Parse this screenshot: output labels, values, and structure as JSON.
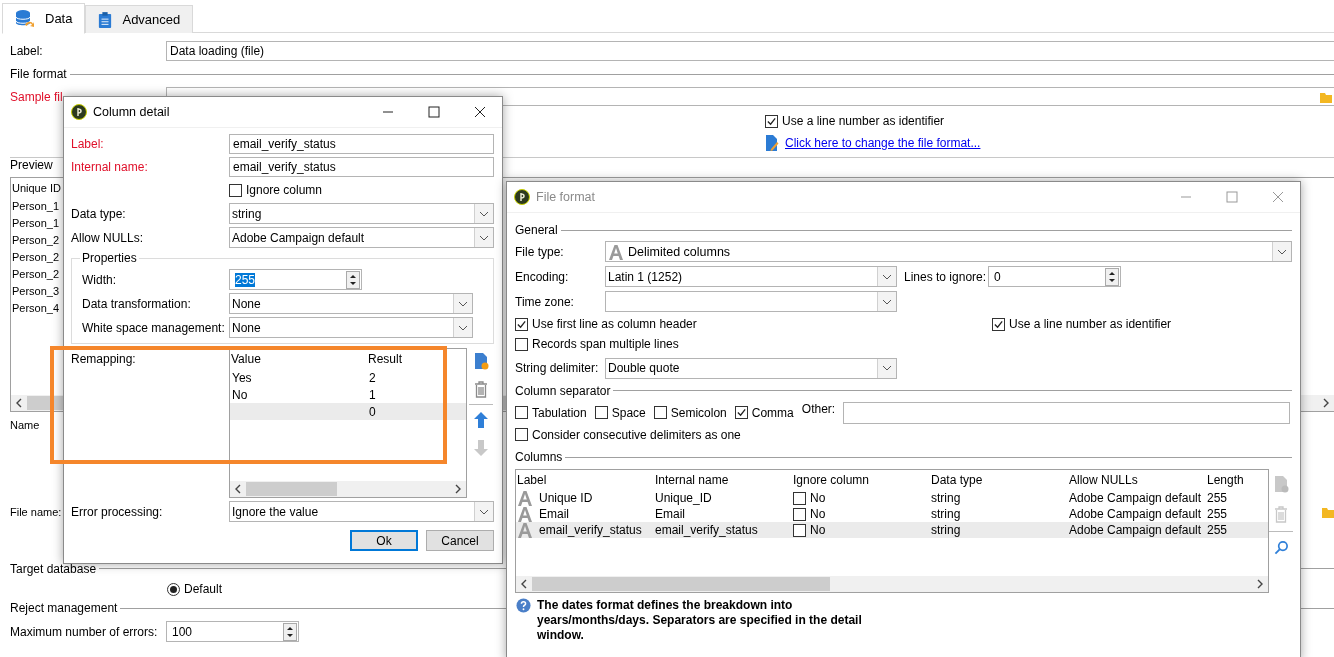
{
  "tabs": [
    {
      "label": "Data",
      "selected": true
    },
    {
      "label": "Advanced",
      "selected": false
    }
  ],
  "form": {
    "label_field": {
      "label": "Label:",
      "value": "Data loading (file)"
    },
    "file_format_heading": "File format",
    "sample_file_label": "Sample fil",
    "line_number_check": {
      "label": "Use a line number as identifier",
      "checked": true
    },
    "change_format_link": "Click here to change the file format...",
    "preview_heading": "Preview",
    "preview_header": "Unique ID",
    "preview_rows": [
      "Person_1",
      "Person_1",
      "Person_2",
      "Person_2",
      "Person_2",
      "Person_3",
      "Person_4"
    ],
    "name_label": "Name",
    "file_name_label": "File name:",
    "target_heading": "Target database",
    "default_radio": {
      "label": "Default",
      "selected": true
    },
    "reject_heading": "Reject management",
    "max_errors": {
      "label": "Maximum number of errors:",
      "value": "100"
    }
  },
  "column_detail": {
    "title": "Column detail",
    "fields": [
      {
        "label": "Label:",
        "value": "email_verify_status",
        "required": true
      },
      {
        "label": "Internal name:",
        "value": "email_verify_status",
        "required": true
      }
    ],
    "ignore_column": {
      "label": "Ignore column",
      "checked": false
    },
    "data_type": {
      "label": "Data type:",
      "value": "string"
    },
    "allow_nulls": {
      "label": "Allow NULLs:",
      "value": "Adobe Campaign default"
    },
    "properties": {
      "heading": "Properties",
      "width": {
        "label": "Width:",
        "value": "255"
      },
      "data_transformation": {
        "label": "Data transformation:",
        "value": "None"
      },
      "white_space": {
        "label": "White space management:",
        "value": "None"
      }
    },
    "remapping": {
      "label": "Remapping:",
      "columns": [
        "Value",
        "Result"
      ],
      "rows": [
        {
          "value": "Yes",
          "result": "2",
          "selected": false
        },
        {
          "value": "No",
          "result": "1",
          "selected": false
        },
        {
          "value": "",
          "result": "0",
          "selected": true
        }
      ]
    },
    "tools": [
      {
        "kind": "add",
        "disabled": false
      },
      {
        "kind": "delete",
        "disabled": false
      },
      {
        "kind": "up",
        "disabled": false
      },
      {
        "kind": "down",
        "disabled": true
      }
    ],
    "error_processing": {
      "label": "Error processing:",
      "value": "Ignore the value"
    },
    "buttons": [
      {
        "label": "Ok",
        "default": true
      },
      {
        "label": "Cancel",
        "default": false
      }
    ]
  },
  "file_format": {
    "title": "File format",
    "general_heading": "General",
    "file_type": {
      "label": "File type:",
      "value": "Delimited columns"
    },
    "encoding": {
      "label": "Encoding:",
      "value": "Latin 1 (1252)"
    },
    "lines_to_ignore": {
      "label": "Lines to ignore:",
      "value": "0"
    },
    "time_zone": {
      "label": "Time zone:"
    },
    "first_line_header": {
      "label": "Use first line as column header",
      "checked": true
    },
    "line_number_identifier": {
      "label": "Use a line number as identifier",
      "checked": true
    },
    "records_span": {
      "label": "Records span multiple lines",
      "checked": false
    },
    "string_delimiter": {
      "label": "String delimiter:",
      "value": "Double quote"
    },
    "separator_heading": "Column separator",
    "separators": [
      {
        "label": "Tabulation",
        "checked": false
      },
      {
        "label": "Space",
        "checked": false
      },
      {
        "label": "Semicolon",
        "checked": false
      },
      {
        "label": "Comma",
        "checked": true
      }
    ],
    "other_label": "Other:",
    "consecutive": {
      "label": "Consider consecutive delimiters as one",
      "checked": false
    },
    "columns_heading": "Columns",
    "table": {
      "columns": [
        "Label",
        "Internal name",
        "Ignore column",
        "Data type",
        "Allow NULLs",
        "Length"
      ],
      "rows": [
        {
          "label": "Unique ID",
          "internal_name": "Unique_ID",
          "ignore": "No",
          "ignored": false,
          "data_type": "string",
          "allow_nulls": "Adobe Campaign default",
          "length": "255",
          "selected": false
        },
        {
          "label": "Email",
          "internal_name": "Email",
          "ignore": "No",
          "ignored": false,
          "data_type": "string",
          "allow_nulls": "Adobe Campaign default",
          "length": "255",
          "selected": false
        },
        {
          "label": "email_verify_status",
          "internal_name": "email_verify_status",
          "ignore": "No",
          "ignored": false,
          "data_type": "string",
          "allow_nulls": "Adobe Campaign default",
          "length": "255",
          "selected": true
        }
      ]
    },
    "tools": [
      {
        "kind": "add",
        "disabled": true
      },
      {
        "kind": "delete",
        "disabled": true
      },
      {
        "kind": "search",
        "disabled": false
      }
    ],
    "note": "The dates format defines the breakdown into years/months/days. Separators are specified in the detail window."
  }
}
